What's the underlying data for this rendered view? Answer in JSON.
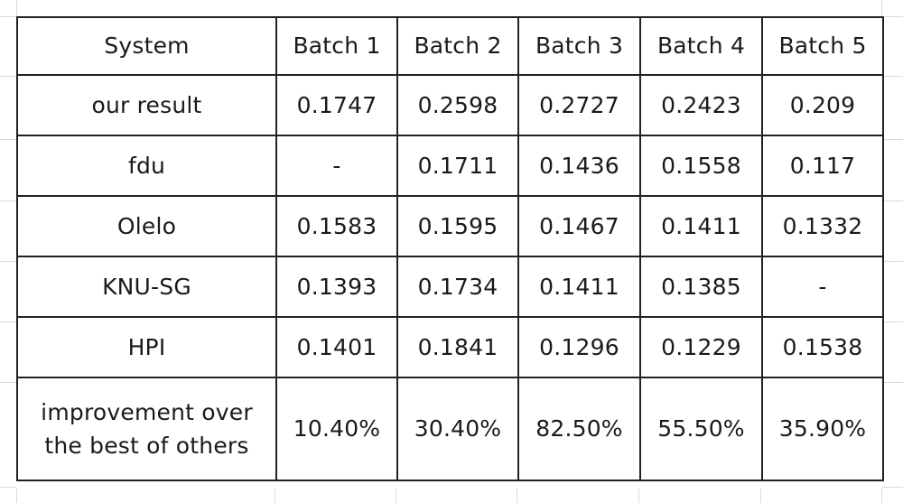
{
  "table": {
    "header": {
      "system_label": "System",
      "batches": [
        "Batch 1",
        "Batch 2",
        "Batch 3",
        "Batch 4",
        "Batch 5"
      ]
    },
    "rows": [
      {
        "system": "our result",
        "values": [
          "0.1747",
          "0.2598",
          "0.2727",
          "0.2423",
          "0.209"
        ]
      },
      {
        "system": "fdu",
        "values": [
          "-",
          "0.1711",
          "0.1436",
          "0.1558",
          "0.117"
        ]
      },
      {
        "system": "Olelo",
        "values": [
          "0.1583",
          "0.1595",
          "0.1467",
          "0.1411",
          "0.1332"
        ]
      },
      {
        "system": "KNU-SG",
        "values": [
          "0.1393",
          "0.1734",
          "0.1411",
          "0.1385",
          "-"
        ]
      },
      {
        "system": "HPI",
        "values": [
          "0.1401",
          "0.1841",
          "0.1296",
          "0.1229",
          "0.1538"
        ]
      }
    ],
    "improvement": {
      "label_line1": "improvement over",
      "label_line2": "the best of others",
      "values": [
        "10.40%",
        "30.40%",
        "82.50%",
        "55.50%",
        "35.90%"
      ]
    }
  },
  "colors": {
    "border": "#222222",
    "text": "#1a1a1a",
    "sheet_gridline": "#d9d9d9",
    "background": "#ffffff"
  }
}
